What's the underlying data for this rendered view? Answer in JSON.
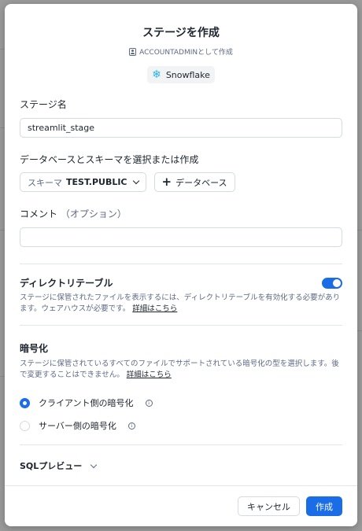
{
  "dialog": {
    "title": "ステージを作成",
    "role_line": "ACCOUNTADMINとして作成",
    "account_chip": "Snowflake"
  },
  "stage_name": {
    "label": "ステージ名",
    "value": "streamlit_stage"
  },
  "database_schema": {
    "label": "データベースとスキーマを選択または作成",
    "schema_prefix": "スキーマ",
    "schema_value": "TEST.PUBLIC",
    "add_database_label": "データベース"
  },
  "comment": {
    "label": "コメント",
    "optional": "（オプション）",
    "value": ""
  },
  "directory_table": {
    "title": "ディレクトリテーブル",
    "description": "ステージに保管されたファイルを表示するには、ディレクトリテーブルを有効化する必要があります。ウェアハウスが必要です。",
    "link": "詳細はこちら",
    "enabled": true
  },
  "encryption": {
    "title": "暗号化",
    "description": "ステージに保管されているすべてのファイルでサポートされている暗号化の型を選択します。後で変更することはできません。",
    "link": "詳細はこちら",
    "options": [
      {
        "label": "クライアント側の暗号化",
        "selected": true
      },
      {
        "label": "サーバー側の暗号化",
        "selected": false
      }
    ]
  },
  "sql_preview": {
    "label": "SQLプレビュー"
  },
  "footer": {
    "cancel_label": "キャンセル",
    "create_label": "作成"
  },
  "colors": {
    "accent": "#1a6ce7",
    "snowflake_brand": "#29b5e8"
  }
}
